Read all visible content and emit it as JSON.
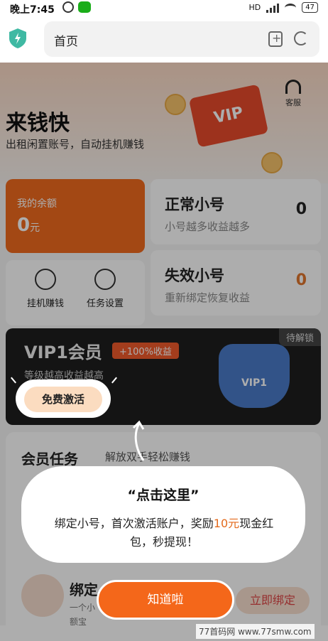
{
  "status": {
    "time": "晚上7:45",
    "signal": "HD",
    "battery": "47"
  },
  "browser": {
    "url": "首页"
  },
  "header": {
    "title": "来钱快",
    "subtitle": "出租闲置账号，自动挂机赚钱",
    "service_label": "客服",
    "vip_illustration_text": "VIP"
  },
  "balance": {
    "label": "我的余额",
    "value": "0",
    "unit": "元"
  },
  "normal_accounts": {
    "title": "正常小号",
    "subtitle": "小号越多收益越多",
    "count": "0"
  },
  "invalid_accounts": {
    "title": "失效小号",
    "subtitle": "重新绑定恢复收益",
    "count": "0"
  },
  "tools": [
    {
      "label": "挂机赚钱",
      "icon": "yuan-icon"
    },
    {
      "label": "任务设置",
      "icon": "settings-icon"
    }
  ],
  "vip": {
    "title": "VIP1会员",
    "tag": "+100%收益",
    "description": "等级越高收益越高",
    "status": "待解锁",
    "badge_text": "VIP1",
    "activate_label": "免费激活"
  },
  "tasks": {
    "title": "会员任务",
    "subtitle": "解放双手轻松赚钱",
    "bind_title": "绑定",
    "bind_sub": "一个小",
    "bind_sub2": "额宝",
    "bind_button": "立即绑定"
  },
  "tooltip": {
    "title": "“点击这里”",
    "body_part1": "绑定小号，首次激活账户，奖励",
    "highlight": "10元",
    "body_part2": "现金红包，秒提现！",
    "confirm_label": "知道啦"
  },
  "watermark": "77首码网 www.77smw.com",
  "colors": {
    "accent": "#f4671a",
    "highlight_text": "#e36a1c"
  }
}
